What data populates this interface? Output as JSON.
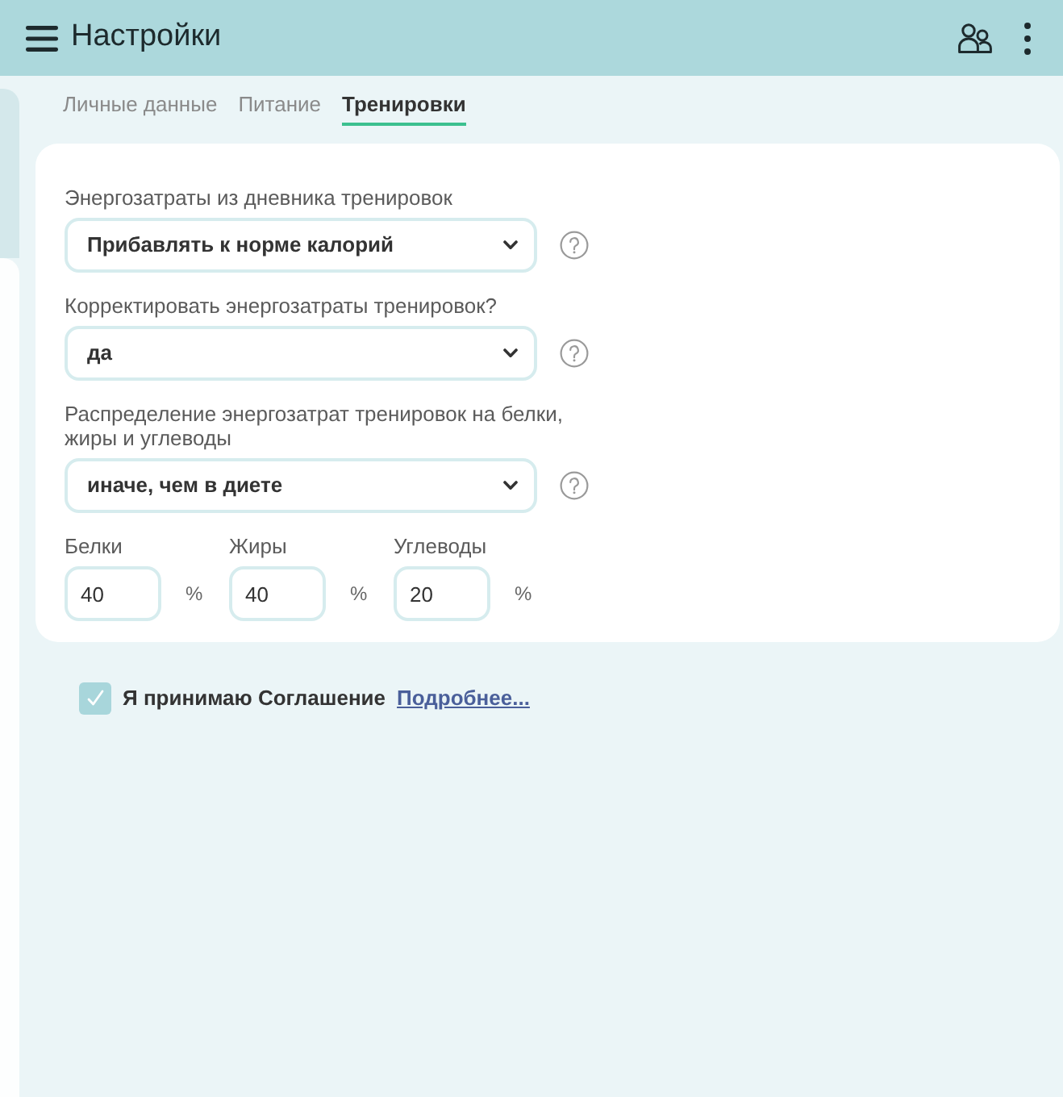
{
  "header": {
    "title": "Настройки"
  },
  "tabs": [
    {
      "label": "Личные данные",
      "selected": false
    },
    {
      "label": "Питание",
      "selected": false
    },
    {
      "label": "Тренировки",
      "selected": true
    }
  ],
  "settings": [
    {
      "label": "Энергозатраты из дневника тренировок",
      "value": "Прибавлять к норме калорий"
    },
    {
      "label": "Корректировать энергозатраты тренировок?",
      "value": "да"
    },
    {
      "label": "Распределение энергозатрат тренировок на белки, жиры и углеводы",
      "value": "иначе, чем в диете"
    }
  ],
  "macros": [
    {
      "label": "Белки",
      "value": "40",
      "unit": "%"
    },
    {
      "label": "Жиры",
      "value": "40",
      "unit": "%"
    },
    {
      "label": "Углеводы",
      "value": "20",
      "unit": "%"
    }
  ],
  "agreement": {
    "checked": true,
    "text": "Я принимаю Соглашение",
    "link": "Подробнее..."
  }
}
